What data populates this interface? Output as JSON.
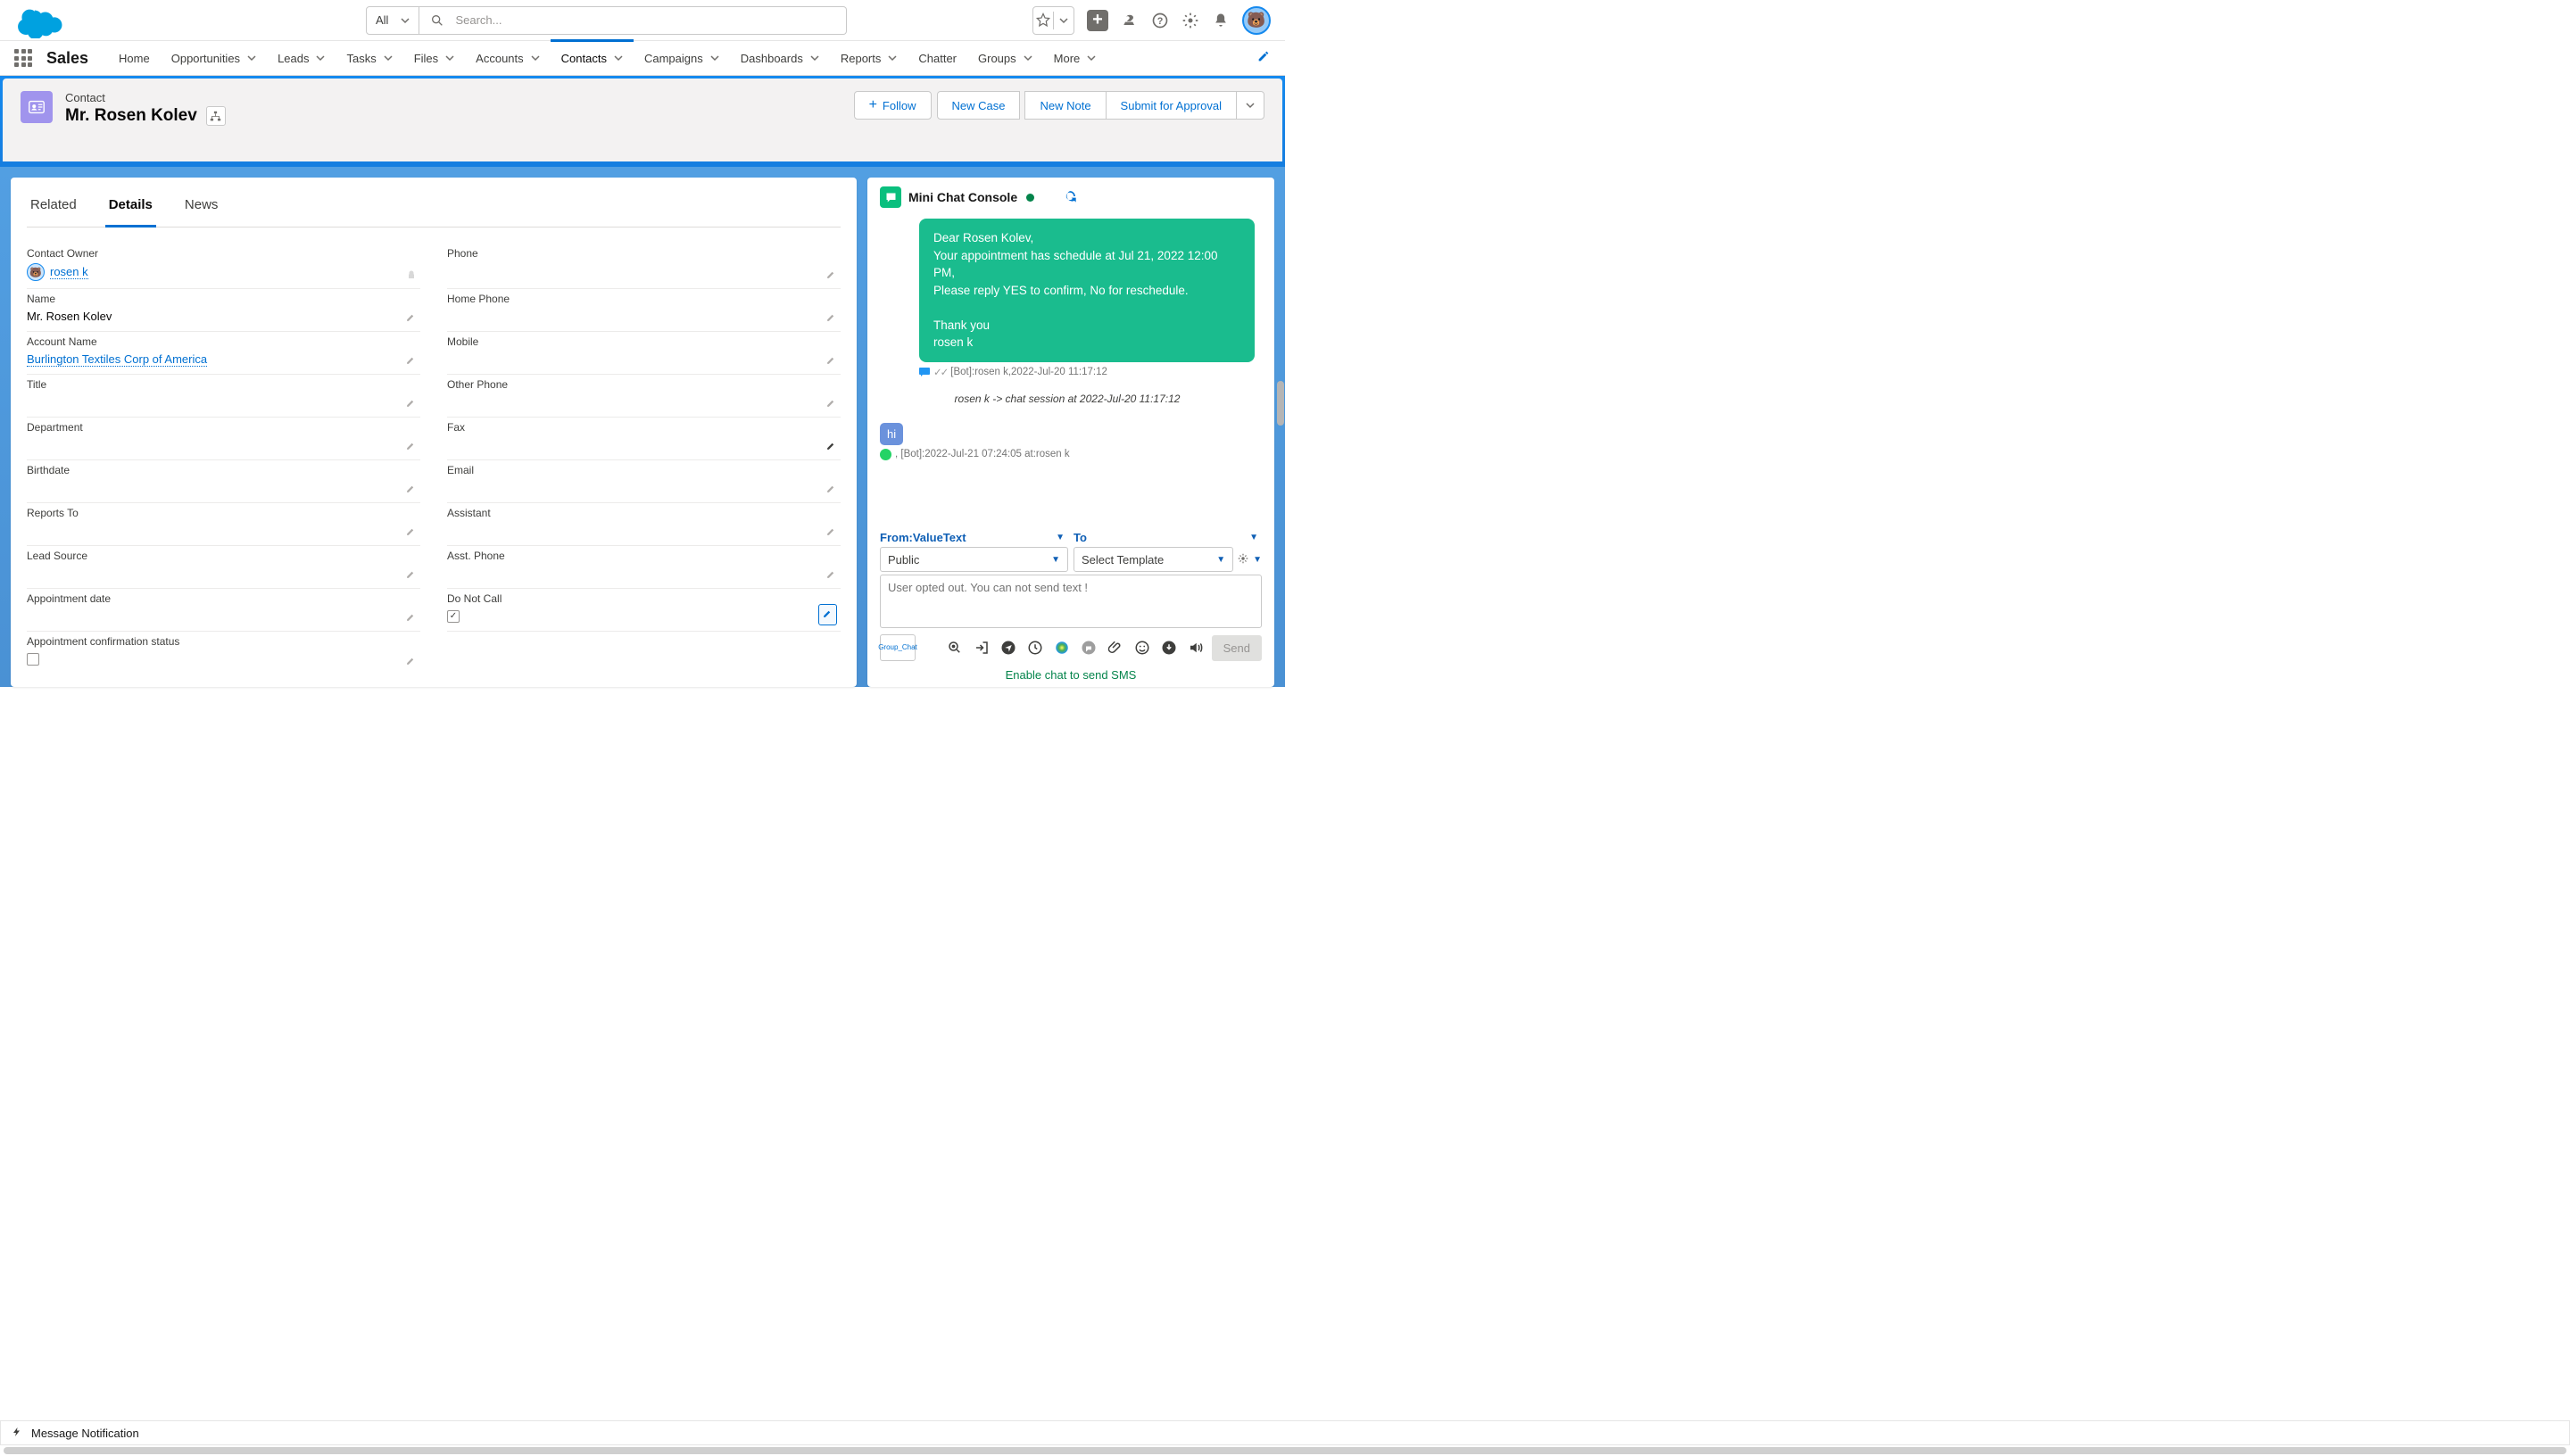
{
  "search": {
    "scope": "All",
    "placeholder": "Search..."
  },
  "app": {
    "name": "Sales"
  },
  "nav": [
    "Home",
    "Opportunities",
    "Leads",
    "Tasks",
    "Files",
    "Accounts",
    "Contacts",
    "Campaigns",
    "Dashboards",
    "Reports",
    "Chatter",
    "Groups",
    "More"
  ],
  "record": {
    "eyebrow": "Contact",
    "title": "Mr. Rosen Kolev",
    "actions": {
      "follow": "Follow",
      "newCase": "New Case",
      "newNote": "New Note",
      "submit": "Submit for Approval"
    }
  },
  "tabs": [
    "Related",
    "Details",
    "News"
  ],
  "details": {
    "left": [
      {
        "label": "Contact Owner",
        "value": "rosen k",
        "link": true,
        "avatar": true
      },
      {
        "label": "Name",
        "value": "Mr. Rosen Kolev"
      },
      {
        "label": "Account Name",
        "value": "Burlington Textiles Corp of America",
        "link": true
      },
      {
        "label": "Title",
        "value": ""
      },
      {
        "label": "Department",
        "value": ""
      },
      {
        "label": "Birthdate",
        "value": ""
      },
      {
        "label": "Reports To",
        "value": ""
      },
      {
        "label": "Lead Source",
        "value": ""
      },
      {
        "label": "Appointment date",
        "value": ""
      },
      {
        "label": "Appointment confirmation status",
        "value": "",
        "checkbox": true,
        "noborder": true
      }
    ],
    "right": [
      {
        "label": "Phone",
        "value": ""
      },
      {
        "label": "Home Phone",
        "value": ""
      },
      {
        "label": "Mobile",
        "value": ""
      },
      {
        "label": "Other Phone",
        "value": ""
      },
      {
        "label": "Fax",
        "value": "",
        "darkpencil": true
      },
      {
        "label": "Email",
        "value": ""
      },
      {
        "label": "Assistant",
        "value": ""
      },
      {
        "label": "Asst. Phone",
        "value": ""
      },
      {
        "label": "Do Not Call",
        "value": "",
        "checkbox": true,
        "checked": true,
        "bluepencil": true
      }
    ]
  },
  "chat": {
    "title": "Mini Chat Console",
    "msg1": "Dear Rosen Kolev,\nYour appointment has schedule at Jul 21, 2022 12:00 PM,\nPlease reply YES to confirm, No for reschedule.\n\nThank you\nrosen k",
    "meta1": "[Bot]:rosen k,2022-Jul-20 11:17:12",
    "session": "rosen k -> chat session at 2022-Jul-20 11:17:12",
    "msg2": "hi",
    "meta2": ", [Bot]:2022-Jul-21 07:24:05 at:rosen k",
    "from_label": "From:",
    "from_val": "ValueText",
    "to_label": "To",
    "visibility": "Public",
    "template": "Select Template",
    "textarea": "User opted out. You can not send text !",
    "groupchat": "Group_Chat",
    "send": "Send",
    "enable": "Enable chat to send SMS"
  },
  "footer": {
    "text": "Message Notification"
  }
}
